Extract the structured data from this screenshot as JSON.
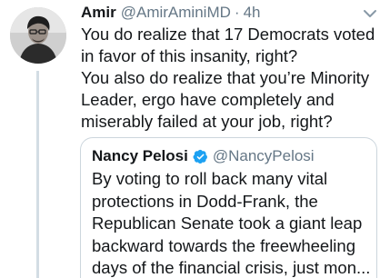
{
  "tweet": {
    "author_name": "Amir",
    "author_handle": "@AmirAminiMD",
    "separator": "·",
    "time": "4h",
    "lines": [
      "You do realize that 17 Democrats voted",
      "in favor of this insanity, right?",
      "You also do realize that you’re Minority",
      "Leader, ergo have completely and",
      "miserably failed at your job, right?"
    ]
  },
  "quoted_tweet": {
    "author_name": "Nancy Pelosi",
    "author_handle": "@NancyPelosi",
    "verified": true,
    "lines": [
      "By voting to roll back many vital",
      "protections in Dodd-Frank, the",
      "Republican Senate took a giant leap",
      "backward towards the freewheeling",
      "days of the financial crisis, just mon..."
    ]
  },
  "colors": {
    "text": "#14171a",
    "secondary_text": "#657786",
    "verified_badge": "#1da1f2",
    "border": "#ccd6dd",
    "thread_line": "#d3dde4"
  },
  "icons": {
    "avatar": "profile-photo",
    "caret": "chevron-down-icon",
    "verified": "verified-badge-icon"
  }
}
